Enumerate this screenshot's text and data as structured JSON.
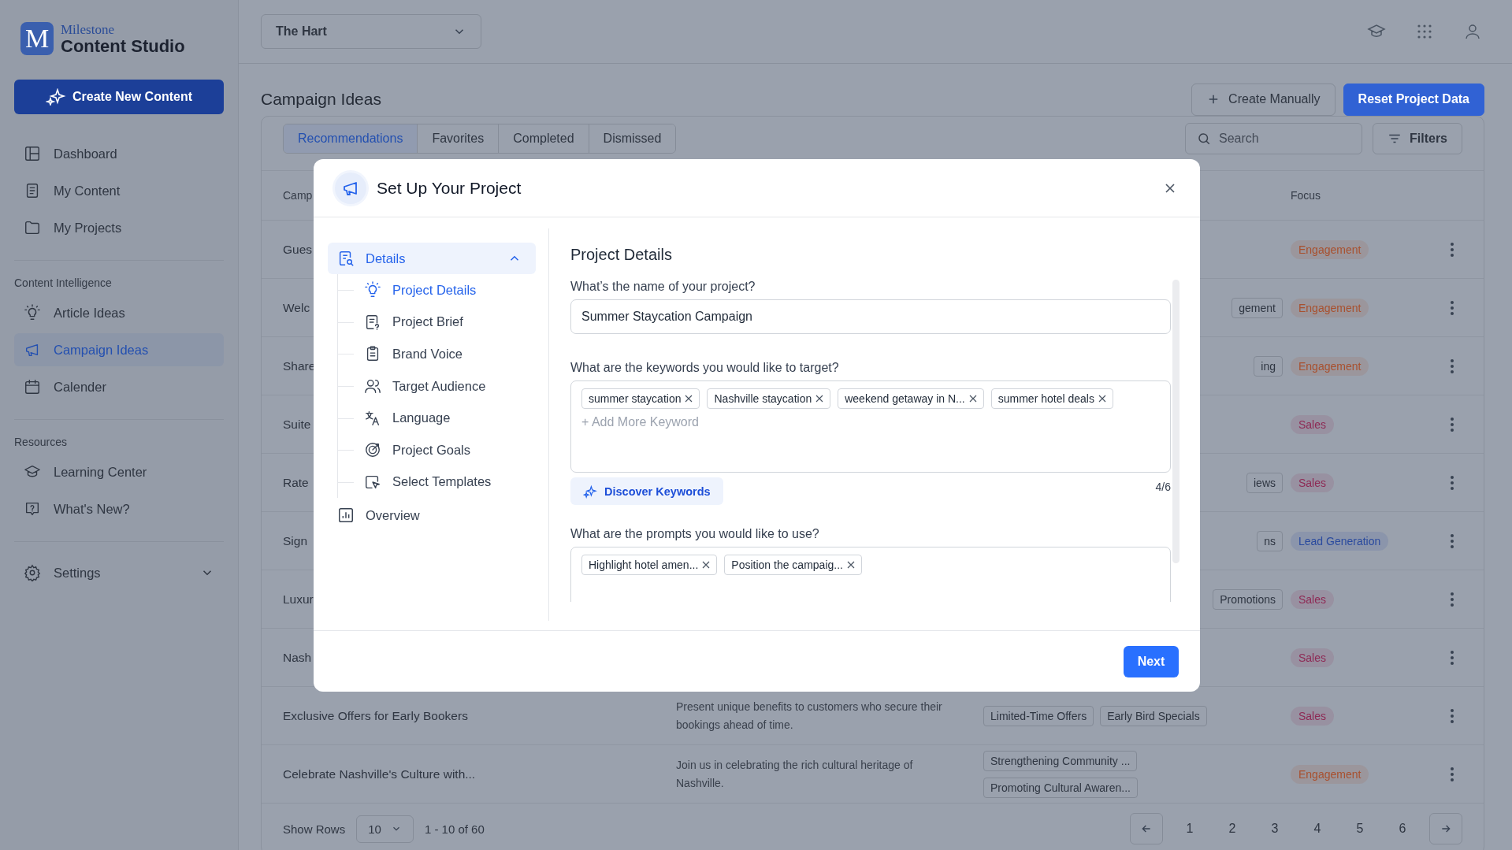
{
  "brand": {
    "letter": "M",
    "small": "Milestone",
    "name": "Content Studio"
  },
  "create_button": "Create New Content",
  "sidebar": {
    "sections": [
      {
        "items": [
          {
            "label": "Dashboard",
            "selected": false
          },
          {
            "label": "My Content",
            "selected": false
          },
          {
            "label": "My Projects",
            "selected": false
          }
        ]
      },
      {
        "heading": "Content Intelligence",
        "items": [
          {
            "label": "Article Ideas",
            "selected": false
          },
          {
            "label": "Campaign Ideas",
            "selected": true
          },
          {
            "label": "Calender",
            "selected": false
          }
        ]
      },
      {
        "heading": "Resources",
        "items": [
          {
            "label": "Learning Center",
            "selected": false
          },
          {
            "label": "What's New?",
            "selected": false
          }
        ]
      }
    ],
    "settings": {
      "label": "Settings",
      "expanded": false
    }
  },
  "topbar": {
    "property": "The Hart"
  },
  "page": {
    "title": "Campaign Ideas",
    "actions": [
      "Create Manually",
      "Reset Project Data"
    ]
  },
  "tabs": [
    {
      "label": "Recommendations",
      "selected": true
    },
    {
      "label": "Favorites",
      "selected": false
    },
    {
      "label": "Completed",
      "selected": false
    },
    {
      "label": "Dismissed",
      "selected": false
    }
  ],
  "search": {
    "placeholder": "Search"
  },
  "filters": "Filters",
  "table": {
    "columns": [
      "Camp",
      "Focus"
    ],
    "rows": [
      {
        "title": "Gues",
        "tags": [],
        "focus": {
          "label": "Engagement",
          "color": "#a8502e"
        }
      },
      {
        "title": "Welc",
        "tags": [
          "gement"
        ],
        "focus": {
          "label": "Engagement",
          "color": "#a8502e"
        }
      },
      {
        "title": "Share",
        "tags": [
          "ing"
        ],
        "focus": {
          "label": "Engagement",
          "color": "#a8502e"
        }
      },
      {
        "title": "Suite",
        "tags": [],
        "focus": {
          "label": "Sales",
          "color": "#8e2a55"
        }
      },
      {
        "title": "Rate",
        "tags": [
          "iews"
        ],
        "focus": {
          "label": "Sales",
          "color": "#8e2a55"
        }
      },
      {
        "title": "Sign",
        "tags": [
          "ns"
        ],
        "focus": {
          "label": "Lead Generation",
          "color": "#2a4a9e"
        }
      },
      {
        "title": "Luxur",
        "tags": [
          "Promotions"
        ],
        "focus": {
          "label": "Sales",
          "color": "#8e2a55"
        }
      },
      {
        "title": "Nash",
        "tags": [],
        "focus": {
          "label": "Sales",
          "color": "#8e2a55"
        }
      },
      {
        "title": "Exclusive Offers for Early Bookers",
        "description": "Present unique benefits to customers who secure their bookings ahead of time.",
        "tags": [
          "Limited-Time Offers",
          "Early Bird Specials"
        ],
        "focus": {
          "label": "Sales",
          "color": "#8e2a55"
        }
      },
      {
        "title": "Celebrate Nashville's Culture with...",
        "description": "Join us in celebrating the rich cultural heritage of Nashville.",
        "tags": [
          "Strengthening Community ...",
          "Promoting Cultural Awaren..."
        ],
        "focus": {
          "label": "Engagement",
          "color": "#a8502e"
        }
      }
    ]
  },
  "pagination": {
    "label": "Show Rows",
    "rows": "10",
    "range": "1 - 10 of 60",
    "pages": [
      "1",
      "2",
      "3",
      "4",
      "5",
      "6"
    ]
  },
  "modal": {
    "title": "Set Up Your Project",
    "nav": [
      {
        "label": "Details",
        "selected": true,
        "expanded": true,
        "children": [
          {
            "label": "Project Details",
            "selected": true
          },
          {
            "label": "Project Brief",
            "selected": false
          },
          {
            "label": "Brand Voice",
            "selected": false
          },
          {
            "label": "Target Audience",
            "selected": false
          },
          {
            "label": "Language",
            "selected": false
          },
          {
            "label": "Project Goals",
            "selected": false
          },
          {
            "label": "Select Templates",
            "selected": false
          }
        ]
      },
      {
        "label": "Overview",
        "selected": false
      }
    ],
    "heading": "Project Details",
    "name_field": {
      "label": "What’s the name of your project?",
      "value": "Summer Staycation Campaign"
    },
    "keywords": {
      "label": "What are the keywords you would like to target?",
      "chips": [
        "summer staycation",
        "Nashville staycation",
        "weekend getaway in N...",
        "summer hotel deals"
      ],
      "placeholder": "+ Add More Keyword",
      "count": "4/6"
    },
    "discover": "Discover Keywords",
    "prompts": {
      "label": "What are the prompts you would like to use?",
      "chips": [
        "Highlight hotel amen...",
        "Position the campaig..."
      ]
    },
    "next": "Next"
  }
}
